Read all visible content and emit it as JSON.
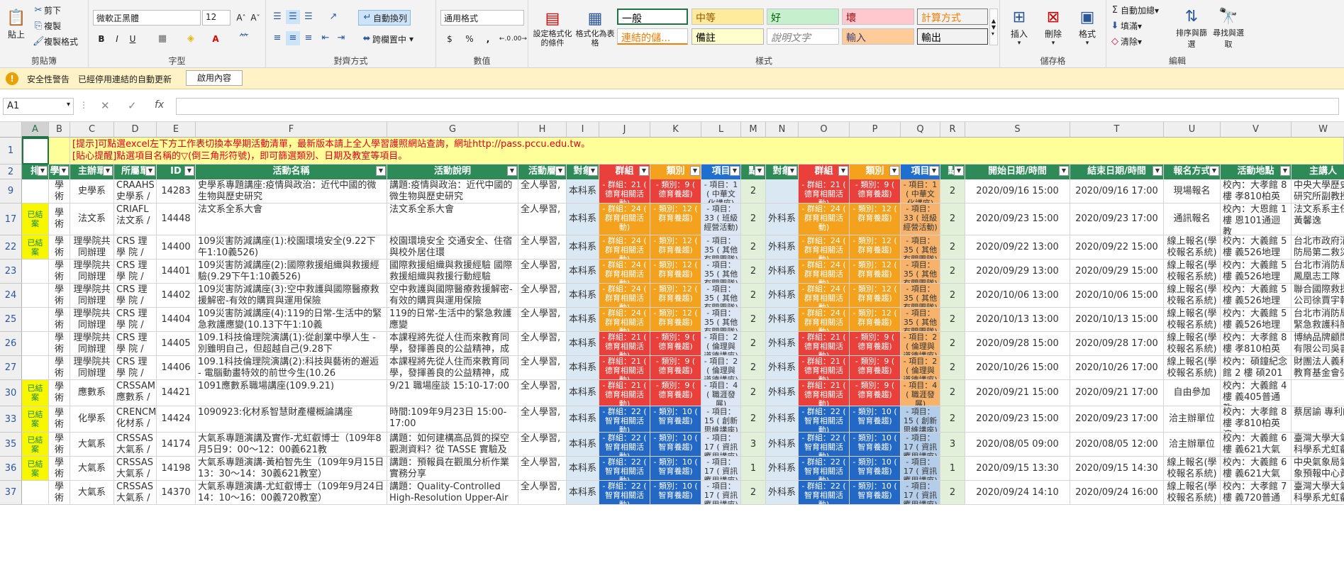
{
  "ribbon": {
    "clipboard": {
      "paste": "貼上",
      "cut": "剪下",
      "copy": "複製",
      "format_painter": "複製格式",
      "label": "剪貼簿"
    },
    "font": {
      "name": "微軟正黑體",
      "size": "12",
      "label": "字型",
      "bold": "B",
      "italic": "I",
      "underline": "U"
    },
    "align": {
      "wrap": "自動換列",
      "merge": "跨欄置中",
      "label": "對齊方式"
    },
    "number": {
      "format": "通用格式",
      "currency": "$",
      "percent": "%",
      "comma": ",",
      "label": "數值"
    },
    "styles": {
      "cond": "設定格式化的條件",
      "table": "格式化為表格",
      "label": "樣式",
      "items": [
        {
          "t": "一般"
        },
        {
          "t": "中等"
        },
        {
          "t": "好"
        },
        {
          "t": "壞"
        },
        {
          "t": "計算方式"
        },
        {
          "t": "連結的儲..."
        },
        {
          "t": "備註"
        },
        {
          "t": "說明文字"
        },
        {
          "t": "輸入"
        },
        {
          "t": "輸出"
        }
      ]
    },
    "cells": {
      "insert": "插入",
      "delete": "刪除",
      "format": "格式",
      "label": "儲存格"
    },
    "editing": {
      "autosum": "自動加總",
      "fill": "填滿",
      "clear": "清除",
      "sort": "排序與篩選",
      "find": "尋找與選取",
      "label": "編輯"
    }
  },
  "security": {
    "title": "安全性警告",
    "message": "已經停用連結的自動更新",
    "button": "啟用內容"
  },
  "formula_bar": {
    "name_box": "A1",
    "fx": "fx",
    "value": ""
  },
  "columns": [
    "A",
    "B",
    "C",
    "D",
    "E",
    "F",
    "G",
    "H",
    "I",
    "J",
    "K",
    "L",
    "M",
    "N",
    "O",
    "P",
    "Q",
    "R",
    "S",
    "T",
    "U",
    "V",
    "W",
    "X"
  ],
  "notice": {
    "line1": "[提示]可點選excel左下方工作表切換本學期活動清單，最新版本請上全人學習護照網站查詢，網址http://pass.pccu.edu.tw。",
    "line2": "[貼心提醒]點選項目名稱的▽(倒三角形符號)，即可篩選類別、日期及教室等項目。"
  },
  "headers": [
    "排",
    "學期",
    "主辦單",
    "所屬單",
    "ID",
    "活動名稱",
    "活動說明",
    "活動層",
    "對象",
    "群組",
    "類別",
    "項目",
    "點",
    "對象",
    "群組",
    "類別",
    "項目",
    "點",
    "開始日期/時間",
    "結束日期/時間",
    "報名方式",
    "活動地點",
    "主講人",
    "主講人"
  ],
  "rows": [
    {
      "num": "9",
      "a": "",
      "b": "學術",
      "c": "史學系",
      "d": "CRAAHS 史學系 /",
      "e": "14283",
      "f": "史學系專題講座:疫情與政治：近代中國的微生物與歷史研究",
      "g": "講題:疫情與政治：近代中國的微生物與歷史研究",
      "h": "全人學習,",
      "i": "本科系",
      "j": "- 群組：21 ( 德育相關活動)",
      "k": "- 類別：9 ( 德育養趨)",
      "l": "- 項目：1 ( 中華文化講座)",
      "m": "2",
      "n": "",
      "o": "- 群組：21 ( 德育相關活動)",
      "p": "- 類別：9 ( 德育養趨)",
      "q": "- 項目：1 ( 中華文化講座)",
      "r": "2",
      "s": "2020/09/16 15:00",
      "t": "2020/09/16 17:00",
      "u": "現場報名",
      "v": "校內：大孝館 8 樓 孝810柏英演",
      "w": "中央大學歷史研究所副教授"
    },
    {
      "num": "17",
      "a": "已結案",
      "b": "學術",
      "c": "法文系",
      "d": "CRIAFL 法文系 /",
      "e": "14448",
      "f": "法文系全系大會",
      "g": "法文系全系大會",
      "h": "全人學習,",
      "i": "本科系",
      "j": "- 群組：24 ( 群育相關活動)",
      "k": "- 類別：12 ( 群育養趨)",
      "l": "- 項目：33 ( 班級經營活動)",
      "m": "2",
      "n": "外科系",
      "o": "- 群組：24 ( 群育相關活動)",
      "p": "- 類別：12 ( 群育養趨)",
      "q": "- 項目：33 ( 班級經營活動)",
      "r": "2",
      "s": "2020/09/23 15:00",
      "t": "2020/09/23 17:00",
      "u": "通訊報名",
      "v": "校內：大恩館 1 樓 恩101通迴教",
      "w": "法文系系主任 黃馨逸"
    },
    {
      "num": "22",
      "a": "已結案",
      "b": "學術",
      "c": "理學院共同辦理",
      "d": "CRS 理學 院 / 林琦",
      "e": "14400",
      "f": "109災害防減講座(1):校園環境安全(9.22下午1:10義526)",
      "g": "校園環境安全 交通安全、住宿與校外居住環",
      "h": "全人學習,",
      "i": "本科系",
      "j": "- 群組：24 ( 群育相關活動)",
      "k": "- 類別：12 ( 群育養趨)",
      "l": "- 項目：35 ( 其他有關團隊)",
      "m": "2",
      "n": "外科系",
      "o": "- 群組：24 ( 群育相關活動)",
      "p": "- 類別：12 ( 群育養趨)",
      "q": "- 項目：35 ( 其他有關團隊)",
      "r": "2",
      "s": "2020/09/22 13:00",
      "t": "2020/09/22 15:00",
      "u": "線上報名(學校報名系統)",
      "v": "校內：大義館 5 樓 義526地理系",
      "w": "台北市政府消防局第二救災"
    },
    {
      "num": "23",
      "a": "",
      "b": "學術",
      "c": "理學院共同辦理",
      "d": "CRS 理學 院 / 林琦",
      "e": "14401",
      "f": "109災害防減講座(2):國際救援組織與救援經驗(9.29下午1:10義526)",
      "g": "國際救援組織與救援經驗 國際救援組織與救援行動經驗",
      "h": "全人學習,",
      "i": "本科系",
      "j": "- 群組：24 ( 群育相關活動)",
      "k": "- 類別：12 ( 群育養趨)",
      "l": "- 項目：35 ( 其他有關團隊)",
      "m": "2",
      "n": "外科系",
      "o": "- 群組：24 ( 群育相關活動)",
      "p": "- 類別：12 ( 群育養趨)",
      "q": "- 項目：35 ( 其他有關團隊)",
      "r": "2",
      "s": "2020/09/29 13:00",
      "t": "2020/09/29 15:00",
      "u": "線上報名(學校報名系統)",
      "v": "校內：大義館 5 樓 義526地理系",
      "w": "台北市消防局 鳳凰志工隊"
    },
    {
      "num": "24",
      "a": "",
      "b": "學術",
      "c": "理學院共同辦理",
      "d": "CRS 理學 院 / 林琦",
      "e": "14402",
      "f": "109災害防減講座(3):空中救護與國際醫療救援解密-有效的購買與運用保險",
      "g": "空中救護與國際醫療救援解密-有效的購買與運用保險",
      "h": "全人學習,",
      "i": "本科系",
      "j": "- 群組：24 ( 群育相關活動)",
      "k": "- 類別：12 ( 群育養趨)",
      "l": "- 項目：35 ( 其他有關團隊)",
      "m": "2",
      "n": "外科系",
      "o": "- 群組：24 ( 群育相關活動)",
      "p": "- 類別：12 ( 群育養趨)",
      "q": "- 項目：35 ( 其他有關團隊)",
      "r": "2",
      "s": "2020/10/06 13:00",
      "t": "2020/10/06 15:00",
      "u": "線上報名(學校報名系統)",
      "v": "校內：大義館 5 樓 義526地理系",
      "w": "聯合國際救援公司徐賈宇執"
    },
    {
      "num": "25",
      "a": "",
      "b": "學術",
      "c": "理學院共同辦理",
      "d": "CRS 理學 院 / 林琦",
      "e": "14404",
      "f": "109災害防減講座(4):119的日常-生活中的緊急救護應變(10.13下午1:10義",
      "g": "119的日常-生活中的緊急救護應變",
      "h": "全人學習,",
      "i": "本科系",
      "j": "- 群組：24 ( 群育相關活動)",
      "k": "- 類別：12 ( 群育養趨)",
      "l": "- 項目：35 ( 其他有關團隊)",
      "m": "2",
      "n": "外科系",
      "o": "- 群組：24 ( 群育相關活動)",
      "p": "- 類別：12 ( 群育養趨)",
      "q": "- 項目：35 ( 其他有關團隊)",
      "r": "2",
      "s": "2020/10/13 13:00",
      "t": "2020/10/13 15:00",
      "u": "線上報名(學校報名系統)",
      "v": "校內：大義館 5 樓 義526地理系",
      "w": "台北市消防局 緊急救護科簡"
    },
    {
      "num": "26",
      "a": "",
      "b": "學術",
      "c": "理學院共同辦理",
      "d": "CRS 理學 院 / 林琦",
      "e": "14405",
      "f": "109.1科技倫理院演講(1):從創業中學人生 - 別雖明自己，但超越自己(9.28下",
      "g": "本課程將先從人住而來教育同學，發揮善良的公益精神，成",
      "h": "全人學習,",
      "i": "本科系",
      "j": "- 群組：21 ( 德育相關活動)",
      "k": "- 類別：9 ( 德育養趨)",
      "l": "- 項目：2 ( 倫理與道德講座)",
      "m": "2",
      "n": "外科系",
      "o": "- 群組：21 ( 德育相關活動)",
      "p": "- 類別：9 ( 德育養趨)",
      "q": "- 項目：2 ( 倫理與道德講座)",
      "r": "2",
      "s": "2020/09/28 15:00",
      "t": "2020/09/28 17:00",
      "u": "線上報名(學校報名系統)",
      "v": "校內：大孝館 8 樓 孝810柏英演",
      "w": "博納品牌顧問有限公司吳書"
    },
    {
      "num": "27",
      "a": "",
      "b": "學術",
      "c": "理學院共同辦理",
      "d": "CRS 理學 院 / 林琦",
      "e": "14406",
      "f": "109.1科技倫理院演講(2):科技與藝術的邂逅 - 電腦動畫特效的前世今生(10.26",
      "g": "本課程將先從人住而來教育同學，發揮善良的公益精神，成",
      "h": "全人學習,",
      "i": "本科系",
      "j": "- 群組：21 ( 德育相關活動)",
      "k": "- 類別：9 ( 德育養趨)",
      "l": "- 項目：2 ( 倫理與道德講座)",
      "m": "2",
      "n": "外科系",
      "o": "- 群組：21 ( 德育相關活動)",
      "p": "- 類別：9 ( 德育養趨)",
      "q": "- 項目：2 ( 倫理與道德講座)",
      "r": "2",
      "s": "2020/10/26 15:00",
      "t": "2020/10/26 17:00",
      "u": "線上報名(學校報名系統)",
      "v": "校內：碩鐘紀念館 2 樓 碩201",
      "w": "財團法人義科教育基金會張"
    },
    {
      "num": "30",
      "a": "已結案",
      "b": "學術",
      "c": "應數系",
      "d": "CRSSAM 應數系 /",
      "e": "14421",
      "f": "1091應數系職場講座(109.9.21)",
      "g": "9/21 職場座談 15:10-17:00",
      "h": "全人學習,",
      "i": "本科系",
      "j": "- 群組：21 ( 德育相關活動)",
      "k": "- 類別：9 ( 德育養趨)",
      "l": "- 項目：4 ( 職涯發展)",
      "m": "2",
      "n": "外科系",
      "o": "- 群組：21 ( 德育相關活動)",
      "p": "- 類別：9 ( 德育養趨)",
      "q": "- 項目：4 ( 職涯發展)",
      "r": "2",
      "s": "2020/09/21 15:00",
      "t": "2020/09/21 17:00",
      "u": "自由參加",
      "v": "校內：大義館 4 樓 義405普通教",
      "w": ""
    },
    {
      "num": "33",
      "a": "已結案",
      "b": "學術",
      "c": "化學系",
      "d": "CRENCM 化材系 /",
      "e": "14424",
      "f": "1090923:化材系智慧財產權概論講座",
      "g": "時間:109年9月23日 15:00-17:00",
      "h": "全人學習,",
      "i": "本科系",
      "j": "- 群組：22 ( 智育相關活動)",
      "k": "- 類別：10 ( 智育養趨)",
      "l": "- 項目：15 ( 創新思維講座)",
      "m": "2",
      "n": "外科系",
      "o": "- 群組：22 ( 智育相關活動)",
      "p": "- 類別：10 ( 智育養趨)",
      "q": "- 項目：15 ( 創新思維講座)",
      "r": "2",
      "s": "2020/09/23 15:00",
      "t": "2020/09/23 17:00",
      "u": "洽主辦單位",
      "v": "校內：大孝館 8 樓 孝810柏英演",
      "w": "蔡居諭 專利師"
    },
    {
      "num": "35",
      "a": "已結案",
      "b": "學術",
      "c": "大氣系",
      "d": "CRSSAS 大氣系 /",
      "e": "14174",
      "f": "大氣系專題演講及實作-尤虹叡博士（109年8月5日9：00～12：00義621教",
      "g": "講題：如何建構高品質的探空觀測資料？從 TASSE 實驗及新",
      "h": "全人學習,",
      "i": "本科系",
      "j": "- 群組：22 ( 智育相關活動)",
      "k": "- 類別：10 ( 智育養趨)",
      "l": "- 項目：17 ( 資訊應用講座)",
      "m": "3",
      "n": "外科系",
      "o": "- 群組：22 ( 智育相關活動)",
      "p": "- 類別：10 ( 智育養趨)",
      "q": "- 項目：17 ( 資訊應用講座)",
      "r": "3",
      "s": "2020/08/05 09:00",
      "t": "2020/08/05 12:00",
      "u": "洽主辦單位",
      "v": "校內：大義館 6 樓 義621大氣系",
      "w": "臺灣大學大氣科學系尤虹叡"
    },
    {
      "num": "36",
      "a": "已結案",
      "b": "學術",
      "c": "大氣系",
      "d": "CRSSAS 大氣系 /",
      "e": "14198",
      "f": "大氣系專題演講-黃柏智先生（109年9月15日13：30～14：30義621教室）",
      "g": "講題：預報員在觀風分析作業實務分享",
      "h": "全人學習,",
      "i": "本科系",
      "j": "- 群組：22 ( 智育相關活動)",
      "k": "- 類別：10 ( 智育養趨)",
      "l": "- 項目：17 ( 資訊應用講座)",
      "m": "1",
      "n": "外科系",
      "o": "- 群組：22 ( 智育相關活動)",
      "p": "- 類別：10 ( 智育養趨)",
      "q": "- 項目：17 ( 資訊應用講座)",
      "r": "1",
      "s": "2020/09/15 13:30",
      "t": "2020/09/15 14:30",
      "u": "線上報名(學校報名系統)",
      "v": "校內：大義館 6 樓 義621大氣系",
      "w": "中央氣象局氣象預報中心黃"
    },
    {
      "num": "37",
      "a": "",
      "b": "學術",
      "c": "大氣系",
      "d": "CRSSAS 大氣系 /",
      "e": "14370",
      "f": "大氣系專題演講-尤虹叡博士（109年9月24日14：10～16：00義720教室）",
      "g": "講題：Quality-Controlled High-Resolution Upper-Air",
      "h": "全人學習,",
      "i": "本科系",
      "j": "- 群組：22 ( 智育相關活動)",
      "k": "- 類別：10 ( 智育養趨)",
      "l": "- 項目：17 ( 資訊應用講座)",
      "m": "2",
      "n": "外科系",
      "o": "- 群組：22 ( 智育相關活動)",
      "p": "- 類別：10 ( 智育養趨)",
      "q": "- 項目：17 ( 資訊應用講座)",
      "r": "2",
      "s": "2020/09/24 14:10",
      "t": "2020/09/24 16:00",
      "u": "線上報名(學校報名系統)",
      "v": "校內：大孝館 7 樓 義720普通教",
      "w": "臺灣大學大氣科學系尤虹叡"
    }
  ],
  "colors": {
    "green_header": "#2e8b57",
    "blue_header": "#1f3a93",
    "accent": "#217346",
    "closed": "#f7f700",
    "group_red": "#e9403b",
    "group_orange": "#f4a21d",
    "group_blue": "#2368c4",
    "item_orange": "#f7b36b",
    "light_green": "#e2f0d9"
  }
}
